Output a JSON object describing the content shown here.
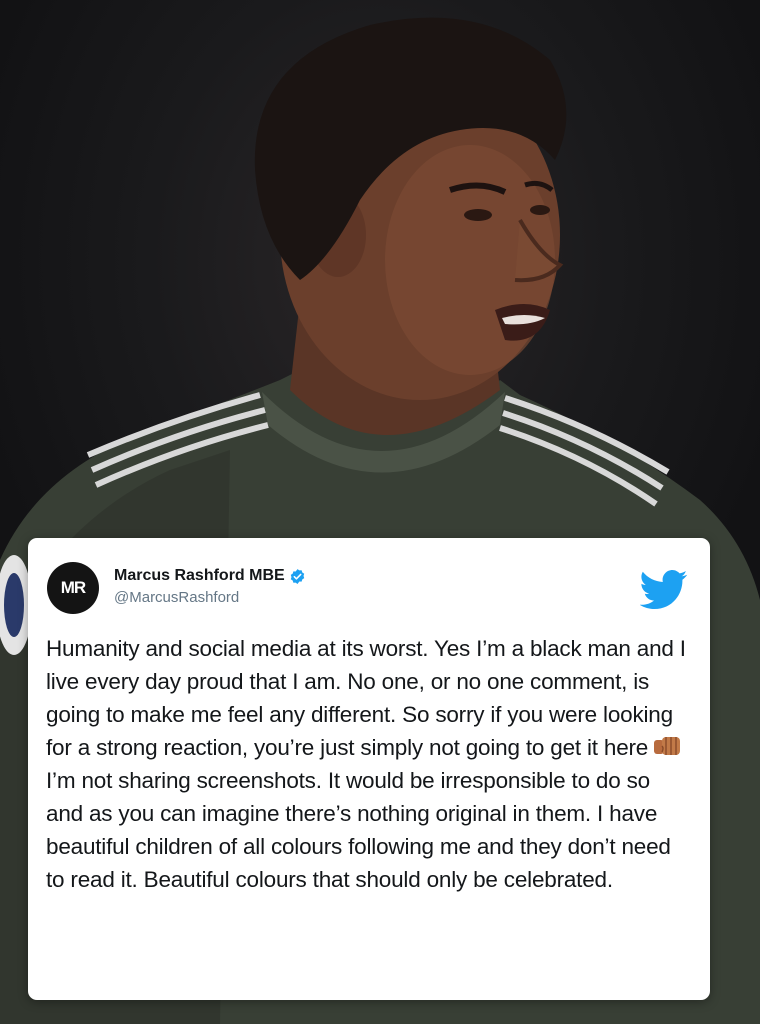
{
  "tweet": {
    "display_name": "Marcus Rashford MBE",
    "handle": "@MarcusRashford",
    "avatar_monogram": "MR",
    "paragraphs": [
      "Humanity and social media at its worst. Yes I’m a black man and I live every day proud that I am. No one, or no one comment, is going to make me feel any different. So sorry if you were looking for a strong reaction, you’re just simply not going to get it here",
      "I’m not sharing screenshots. It would be irresponsible to do so and as you can imagine there’s nothing original in them. I have beautiful children of all colours following me and they don’t need to read it. Beautiful colours that should only be celebrated."
    ],
    "icons": {
      "verified": "verified-badge-icon",
      "platform": "twitter-bird-icon",
      "emoji": "oncoming-fist-emoji"
    }
  },
  "colors": {
    "twitter_blue": "#1da1f2",
    "text": "#14171a",
    "handle": "#657786",
    "jersey": "#3a4236"
  }
}
